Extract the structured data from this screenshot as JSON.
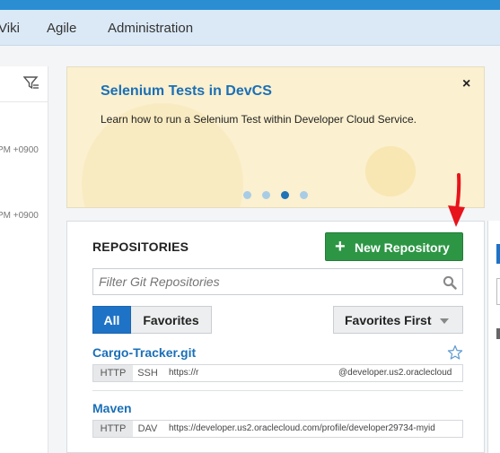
{
  "nav": {
    "items": [
      "Viki",
      "Agile",
      "Administration"
    ]
  },
  "left_panel": {
    "filter_icon": "filter-icon",
    "timestamps": [
      "PM +0900",
      "PM +0900"
    ]
  },
  "banner": {
    "title": "Selenium Tests in DevCS",
    "description": "Learn how to run a Selenium Test within Developer Cloud Service.",
    "close_symbol": "×",
    "dots_count": 4,
    "active_dot": 3
  },
  "repositories": {
    "title": "REPOSITORIES",
    "new_button_label": "New Repository",
    "new_button_icon": "+",
    "search_placeholder": "Filter Git Repositories",
    "filter_all": "All",
    "filter_favorites": "Favorites",
    "sort_label": "Favorites First",
    "items": [
      {
        "name": "Cargo-Tracker.git",
        "protocols": [
          "HTTP",
          "SSH"
        ],
        "url": "https://r",
        "url_tail": "@developer.us2.oraclecloud"
      },
      {
        "name": "Maven",
        "protocols": [
          "HTTP",
          "DAV"
        ],
        "url": "https://developer.us2.oraclecloud.com/profile/developer29734-myid"
      }
    ]
  },
  "colors": {
    "accent": "#1f73c6",
    "new_button": "#2d9645",
    "banner_bg": "#fbf0cf",
    "annotation_arrow": "#e8141b"
  }
}
